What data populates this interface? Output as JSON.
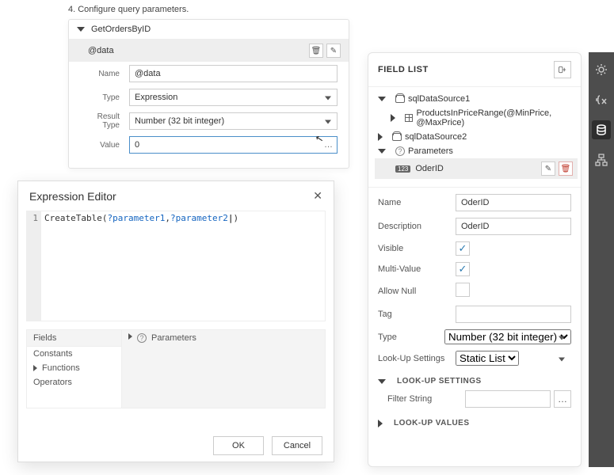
{
  "config": {
    "step_text": "4. Configure query parameters.",
    "query_name": "GetOrdersByID",
    "param_label": "@data",
    "fields": {
      "name_label": "Name",
      "name_value": "@data",
      "type_label": "Type",
      "type_value": "Expression",
      "type_options": [
        "Expression"
      ],
      "result_type_label": "Result Type",
      "result_type_value": "Number (32 bit integer)",
      "result_type_options": [
        "Number (32 bit integer)"
      ],
      "value_label": "Value",
      "value_value": "0"
    }
  },
  "expression_editor": {
    "title": "Expression Editor",
    "code_line_number": "1",
    "code": {
      "fn": "CreateTable(",
      "p1": "?parameter1",
      "sep": ",",
      "p2": "?parameter2",
      "close": ")"
    },
    "left_header": "Fields",
    "left_items": [
      "Constants",
      "Functions",
      "Operators"
    ],
    "right_label": "Parameters",
    "ok": "OK",
    "cancel": "Cancel"
  },
  "field_list": {
    "title": "FIELD LIST",
    "tree": {
      "ds1": "sqlDataSource1",
      "ds1_child": "ProductsInPriceRange(@MinPrice, @MaxPrice)",
      "ds2": "sqlDataSource2",
      "params_label": "Parameters",
      "selected_param": "OderID",
      "selected_type_badge": "123"
    },
    "props": {
      "name_label": "Name",
      "name_value": "OderID",
      "description_label": "Description",
      "description_value": "OderID",
      "visible_label": "Visible",
      "visible_checked": true,
      "multivalue_label": "Multi-Value",
      "multivalue_checked": true,
      "allownull_label": "Allow Null",
      "allownull_checked": false,
      "tag_label": "Tag",
      "tag_value": "",
      "type_label": "Type",
      "type_value": "Number (32 bit integer)",
      "type_options": [
        "Number (32 bit integer)"
      ],
      "lookup_label": "Look-Up Settings",
      "lookup_value": "Static List",
      "lookup_options": [
        "Static List"
      ]
    },
    "lookup_section": "LOOK-UP SETTINGS",
    "filter_label": "Filter String",
    "filter_value": "",
    "lookup_values_section": "LOOK-UP VALUES"
  },
  "sidebar_icons": [
    "gear",
    "fx",
    "database",
    "tree"
  ]
}
